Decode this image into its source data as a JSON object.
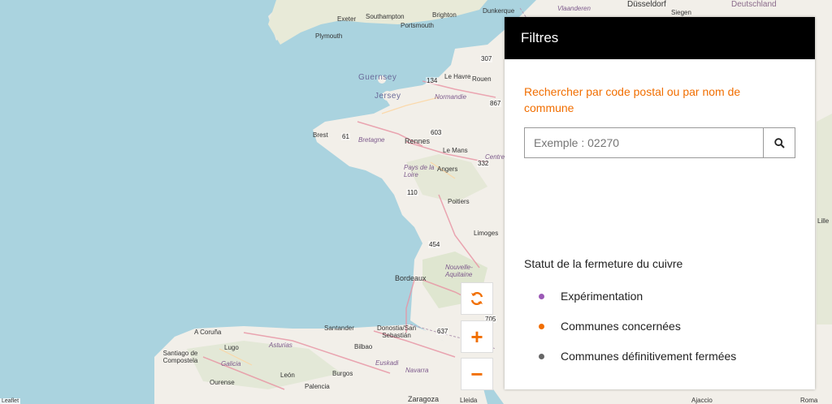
{
  "map": {
    "places": [
      "Exeter",
      "Southampton",
      "Brighton",
      "Plymouth",
      "Portsmouth",
      "Dunkerque",
      "Vlaanderen",
      "Düsseldorf",
      "Siegen",
      "Deutschland",
      "Guernsey",
      "Jersey",
      "Le Havre",
      "Rouen",
      "Normandie",
      "Brest",
      "Bretagne",
      "Rennes",
      "Le Mans",
      "Centre",
      "Pays de la Loire",
      "Angers",
      "Poitiers",
      "Limoges",
      "Nouvelle-Aquitaine",
      "Bordeaux",
      "A Coruña",
      "Lugo",
      "Santiago de Compostela",
      "Galicia",
      "Asturias",
      "Santander",
      "Donostia/San Sebastián",
      "Bilbao",
      "Euskadi",
      "Navarra",
      "Ourense",
      "León",
      "Burgos",
      "Palencia",
      "Zaragoza",
      "Lleida",
      "Ajaccio",
      "Roma",
      "Lille"
    ],
    "route_numbers": [
      "307",
      "134",
      "867",
      "603",
      "61",
      "332",
      "110",
      "454",
      "705",
      "637"
    ],
    "attribution": "Leaflet"
  },
  "controls": {
    "refresh_icon": "refresh-icon",
    "zoom_in": "+",
    "zoom_out": "−"
  },
  "panel": {
    "title": "Filtres",
    "search_label": "Rechercher par code postal ou par nom de commune",
    "search_placeholder": "Exemple : 02270",
    "search_icon": "search-icon",
    "legend_title": "Statut de la fermeture du cuivre",
    "legend": [
      {
        "label": "Expérimentation",
        "color": "#9b59b6"
      },
      {
        "label": "Communes concernées",
        "color": "#f16e00"
      },
      {
        "label": "Communes définitivement fermées",
        "color": "#666666"
      }
    ]
  },
  "colors": {
    "accent": "#f16e00",
    "sea": "#aad3df",
    "land": "#f2efe9"
  }
}
